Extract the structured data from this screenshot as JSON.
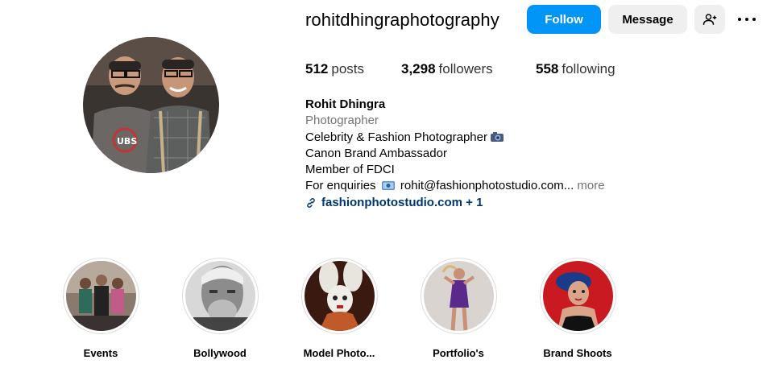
{
  "profile": {
    "username": "rohitdhingraphotography",
    "buttons": {
      "follow": "Follow",
      "message": "Message"
    },
    "icons": {
      "add_user": "add-user-icon",
      "more": "more-options-icon",
      "link": "link-icon"
    },
    "stats": {
      "posts_count": "512",
      "posts_label": "posts",
      "followers_count": "3,298",
      "followers_label": "followers",
      "following_count": "558",
      "following_label": "following"
    },
    "bio": {
      "full_name": "Rohit Dhingra",
      "category": "Photographer",
      "line1": "Celebrity & Fashion Photographer",
      "line2": "Canon Brand Ambassador",
      "line3": "Member of FDCI",
      "line4": "For enquiries",
      "email": "rohit@fashionphotostudio.com...",
      "more": "more",
      "link": "fashionphotostudio.com + 1"
    },
    "colors": {
      "follow_button": "#0095f6",
      "secondary_button": "#efefef",
      "link": "#00376b",
      "muted_text": "#737373"
    }
  },
  "highlights": [
    {
      "label": "Events"
    },
    {
      "label": "Bollywood"
    },
    {
      "label": "Model Photo..."
    },
    {
      "label": "Portfolio's"
    },
    {
      "label": "Brand Shoots"
    }
  ]
}
